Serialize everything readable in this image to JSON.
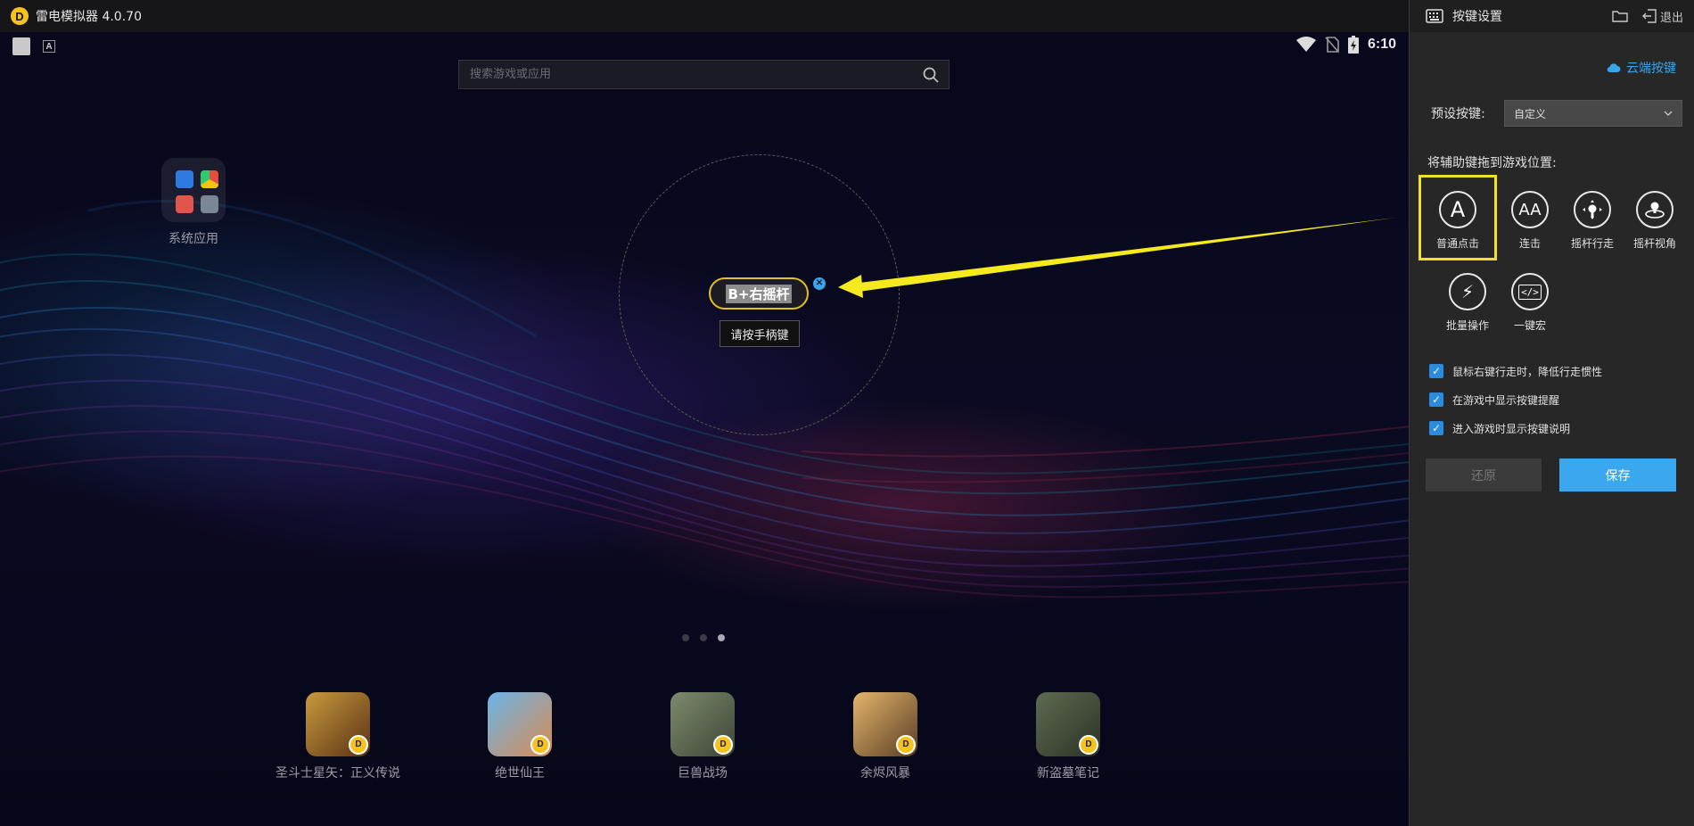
{
  "window": {
    "title": "雷电模拟器 4.0.70",
    "logo_glyph": "D"
  },
  "status_bar": {
    "time": "6:10",
    "key_glyph": "A"
  },
  "search": {
    "placeholder": "搜索游戏或应用"
  },
  "desktop": {
    "folder_label": "系统应用",
    "joystick_key_label": "B+右摇杆",
    "close_glyph": "✕",
    "tooltip": "请按手柄键",
    "page_count": 3,
    "active_page": 3
  },
  "dock": [
    {
      "label": "圣斗士星矢：正义传说",
      "color1": "#c79a3c",
      "color2": "#5b3216"
    },
    {
      "label": "绝世仙王",
      "color1": "#6bb5e8",
      "color2": "#d98a52"
    },
    {
      "label": "巨兽战场",
      "color1": "#7d8a6d",
      "color2": "#3d4636"
    },
    {
      "label": "余烬风暴",
      "color1": "#e4b56c",
      "color2": "#5a3d24"
    },
    {
      "label": "新盗墓笔记",
      "color1": "#5f6b52",
      "color2": "#2b3326"
    }
  ],
  "badge_glyph": "D",
  "panel": {
    "title": "按键设置",
    "exit_label": "退出",
    "cloud_label": "云端按键",
    "preset_label": "预设按键:",
    "preset_value": "自定义",
    "drag_hint": "将辅助键拖到游戏位置:",
    "tools": [
      {
        "label": "普通点击",
        "glyph": "A",
        "selected": true
      },
      {
        "label": "连击",
        "glyph": "AA",
        "selected": false
      },
      {
        "label": "摇杆行走",
        "glyph": "",
        "selected": false
      },
      {
        "label": "摇杆视角",
        "glyph": "",
        "selected": false
      },
      {
        "label": "批量操作",
        "glyph": "⚡",
        "selected": false
      },
      {
        "label": "一键宏",
        "glyph": "</>",
        "selected": false
      }
    ],
    "checkboxes": [
      {
        "label": "鼠标右键行走时，降低行走惯性",
        "checked": true
      },
      {
        "label": "在游戏中显示按键提醒",
        "checked": true
      },
      {
        "label": "进入游戏时显示按键说明",
        "checked": true
      }
    ],
    "check_glyph": "✓",
    "restore_label": "还原",
    "save_label": "保存"
  },
  "colors": {
    "accent": "#3aa8ee",
    "highlight": "#f2e227",
    "logo": "#f4c321"
  }
}
